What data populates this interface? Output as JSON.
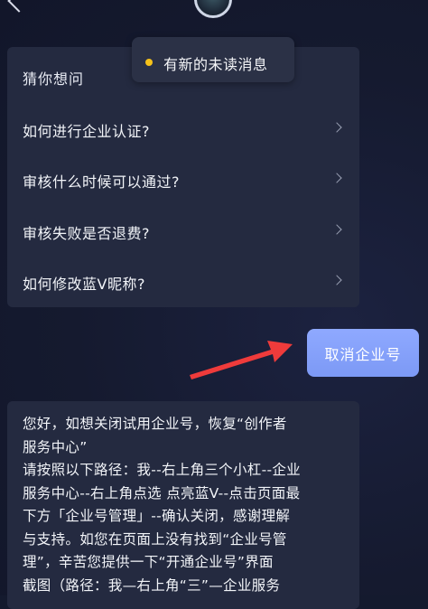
{
  "header": {
    "back_icon": "chevron-left-icon",
    "avatar_icon": "avatar-icon"
  },
  "toast": {
    "text": "有新的未读消息",
    "dot_color": "#f6c21a"
  },
  "faq": {
    "title": "猜你想问",
    "items": [
      {
        "label": "如何进行企业认证?"
      },
      {
        "label": "审核什么时候可以通过?"
      },
      {
        "label": "审核失败是否退费?"
      },
      {
        "label": "如何修改蓝V昵称?"
      }
    ]
  },
  "action": {
    "cancel_label": "取消企业号",
    "button_color": "#8fa9ff"
  },
  "reply": {
    "lines": [
      "您好，如想关闭试用企业号，恢复“创作者",
      "服务中心”",
      "请按照以下路径：我--右上角三个小杠--企业",
      "服务中心--右上角点选 点亮蓝V--点击页面最",
      "下方「企业号管理」--确认关闭，感谢理解",
      "与支持。如您在页面上没有找到“企业号管",
      "理”，辛苦您提供一下“开通企业号”界面",
      "截图（路径：我—右上角“三”—企业服务"
    ]
  },
  "colors": {
    "background": "#141a2e",
    "card": "#242a40",
    "annotation_arrow": "#ef3b3b"
  }
}
